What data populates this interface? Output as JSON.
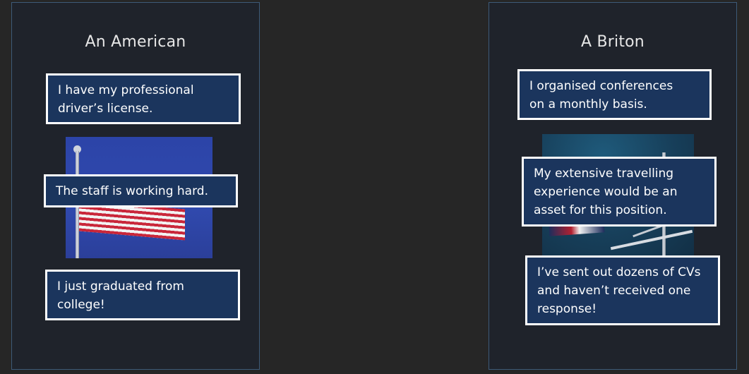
{
  "panels": {
    "american": {
      "title": "An American",
      "photo": "us-flag-photo",
      "cards": [
        "I have my professional\ndriver’s license.",
        "The staff is working hard.",
        "I just graduated from\ncollege!"
      ]
    },
    "briton": {
      "title": "A Briton",
      "photo": "uk-flag-photo",
      "cards": [
        "I organised conferences\non a monthly basis.",
        "My extensive travelling\nexperience would be an\nasset for this position.",
        "I’ve sent out dozens of CVs\nand haven’t received one\nresponse!"
      ]
    }
  },
  "colors": {
    "background": "#262626",
    "panel": "#1f232b",
    "panel_border": "#3d5a78",
    "card_fill": "#1b355d",
    "card_border": "#ffffff"
  }
}
